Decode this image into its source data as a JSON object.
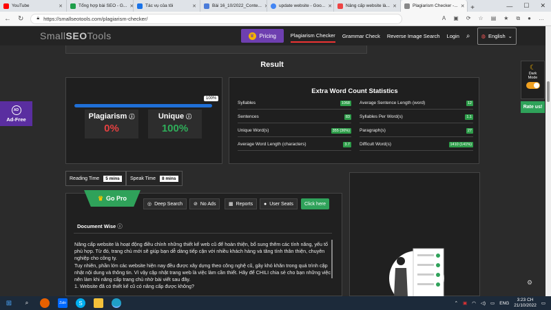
{
  "browser": {
    "tabs": [
      {
        "title": "YouTube",
        "color": "#ff0000",
        "active": false
      },
      {
        "title": "Tổng hợp bài SEO - G...",
        "color": "#1e9e4a",
        "active": false
      },
      {
        "title": "Tác vụ của tôi",
        "color": "#1a73e8",
        "active": false
      },
      {
        "title": "Bài 16_10/2022_Conte...",
        "color": "#4a7bd9",
        "active": false
      },
      {
        "title": "update website - Goo...",
        "color": "#4285f4",
        "active": false
      },
      {
        "title": "Nâng cấp website là...",
        "color": "#e44",
        "active": false
      },
      {
        "title": "Plagiarism Checker -...",
        "color": "#888",
        "active": true
      }
    ],
    "url": "https://smallseotools.com/plagiarism-checker/"
  },
  "site": {
    "logo_part1": "Small",
    "logo_part2": "SEO",
    "logo_part3": "Tools",
    "pricing": "Pricing",
    "nav": [
      "Plagiarism Checker",
      "Grammar Check",
      "Reverse Image Search",
      "Login"
    ],
    "language": "English"
  },
  "result": {
    "title": "Result",
    "progress_label": "100%",
    "progress": 1.0,
    "plagiarism_label": "Plagiarism",
    "plagiarism_value": "0%",
    "unique_label": "Unique",
    "unique_value": "100%"
  },
  "stats": {
    "title": "Extra Word Count Statistics",
    "left": [
      {
        "label": "Syllables",
        "value": "1068"
      },
      {
        "label": "Sentences",
        "value": "83"
      },
      {
        "label": "Unique Word(s)",
        "value": "355 (36%)"
      },
      {
        "label": "Average Word Length (characters)",
        "value": "3.7"
      }
    ],
    "right": [
      {
        "label": "Average Sentence Length (word)",
        "value": "12"
      },
      {
        "label": "Syllables Per Word(s)",
        "value": "1.1"
      },
      {
        "label": "Paragraph(s)",
        "value": "27"
      },
      {
        "label": "Difficult Word(s)",
        "value": "1410 (141%)"
      }
    ]
  },
  "times": {
    "reading_label": "Reading Time",
    "reading_value": "5 mins",
    "speak_label": "Speak Time",
    "speak_value": "8 mins"
  },
  "pro": {
    "go_pro": "Go Pro",
    "features": [
      "Deep Search",
      "No Ads",
      "Reports",
      "User Seats"
    ],
    "click_here": "Click here"
  },
  "document": {
    "title": "Document Wise",
    "paragraphs": [
      "Nâng cấp website là hoạt động điều chỉnh những thiết kế web cũ để hoàn thiện, bổ sung thêm các tính năng, yếu tố phù hợp. Từ đó, trang chủ mới sẽ giúp bạn dễ dàng tiếp cận với nhiều khách hàng và tăng tính thân thiện, chuyên nghiệp cho công ty.",
      "Tuy nhiên, phần lớn các website hiện nay đều được xây dựng theo công nghệ cũ, gây khó khăn trong quá trình cập nhật nội dung và thông tin. Vì vậy cập nhật trang web là việc làm cần thiết. Hãy để CHILI chia sẻ cho bạn những việc nên làm khi nâng cấp trang chủ nhờ bài viết sau đây.",
      "1. Website đã có thiết kế cũ có nâng cấp được không?"
    ]
  },
  "side": {
    "ad_free": "Ad-Free",
    "ad_badge": "AD",
    "dark_mode": "Dark Mode",
    "rate_us": "Rate us!"
  },
  "taskbar": {
    "lang": "ENG",
    "time": "3:23 CH",
    "date": "21/10/2022"
  }
}
